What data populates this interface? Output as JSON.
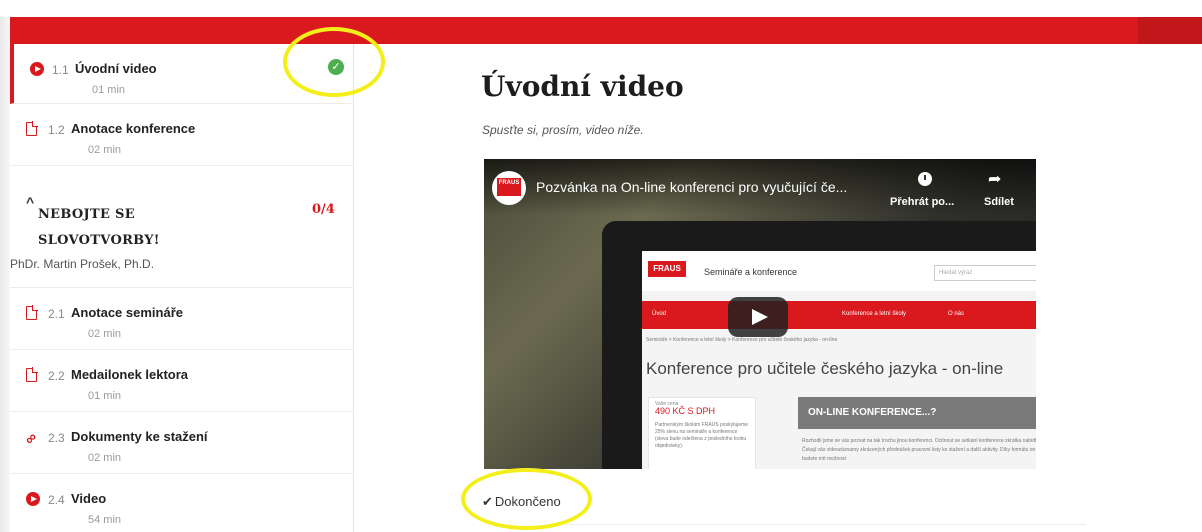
{
  "sidebar": {
    "items_top": [
      {
        "num": "1.1",
        "title": "Úvodní video",
        "duration": "01 min",
        "icon": "play-circle-icon",
        "active": true,
        "completed": true
      },
      {
        "num": "1.2",
        "title": "Anotace konference",
        "duration": "02 min",
        "icon": "document-icon"
      }
    ],
    "section": {
      "title": "NEBOJTE SE SLOVOTVORBY!",
      "count": "0/4",
      "author": "PhDr. Martin Prošek, Ph.D.",
      "expanded": true
    },
    "items_section": [
      {
        "num": "2.1",
        "title": "Anotace semináře",
        "duration": "02 min",
        "icon": "document-icon"
      },
      {
        "num": "2.2",
        "title": "Medailonek lektora",
        "duration": "01 min",
        "icon": "document-icon"
      },
      {
        "num": "2.3",
        "title": "Dokumenty ke stažení",
        "duration": "02 min",
        "icon": "link-icon"
      },
      {
        "num": "2.4",
        "title": "Video",
        "duration": "54 min",
        "icon": "play-circle-icon"
      }
    ]
  },
  "main": {
    "title": "Úvodní video",
    "subtitle": "Spusťte si, prosím, video níže.",
    "video": {
      "title": "Pozvánka na On-line konferenci pro vyučující če...",
      "watch_later": "Přehrát po...",
      "share": "Sdílet",
      "channel_logo": "FRAUS"
    },
    "video_frame": {
      "logo": "FRAUS",
      "site_name": "Semináře a konference",
      "search_placeholder": "Hledat výraz",
      "nav": [
        "Úvod",
        "Konference a letní školy",
        "O nás"
      ],
      "breadcrumb": "Semináře > Konference a letní školy > Konference pro učitele českého jazyka - on-line",
      "heading": "Konference pro učitele českého jazyka - on-line",
      "price_label": "Vaše cena",
      "price": "490 KČ S DPH",
      "card_text": "Partnerským školám FRAUS poskytujeme 25% slevu na semináře a konference (sleva bude odečtena z posledního kroku objednávky).",
      "banner": "ON-LINE KONFERENCE...?",
      "paragraph": "Rozhodli jsme se vás pozvat na tak trochu jinou konferenci. Ocitnout se setkání konference zkrátka nabídli. Čekají vás videozáznamy zkrácených přednášek pracovní listy ke stažení a další aktivity. Díky formátu on-line budete mít možnost"
    },
    "completed_label": "Dokončeno"
  },
  "colors": {
    "brand_red": "#d9191d",
    "success_green": "#4cae4f",
    "highlight_yellow": "#f4ef1b"
  }
}
